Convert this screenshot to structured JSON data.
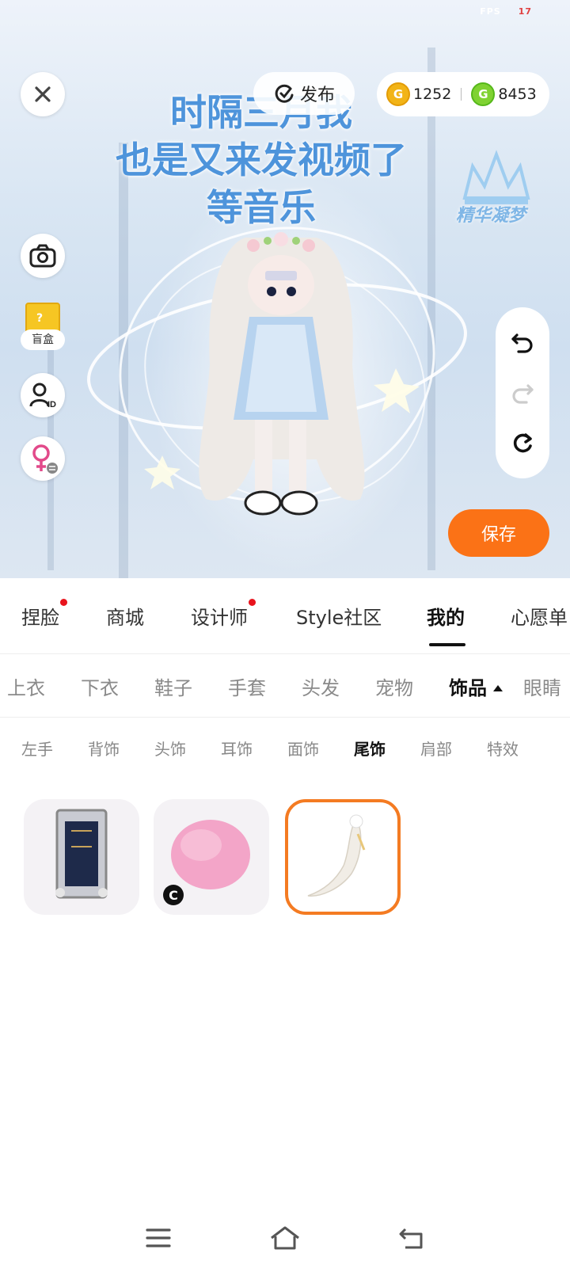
{
  "fps": {
    "label": "FPS",
    "value": "17"
  },
  "header": {
    "publish_label": "发布",
    "gold_coins": "1252",
    "green_coins": "8453"
  },
  "overlay_text": [
    "时隔三月我",
    "也是又来发视频了",
    "等音乐"
  ],
  "logo_text": "精华凝梦",
  "side": {
    "blindbox_label": "盲盒"
  },
  "save_label": "保存",
  "main_tabs": [
    {
      "label": "捏脸",
      "dot": true
    },
    {
      "label": "商城",
      "dot": false
    },
    {
      "label": "设计师",
      "dot": true
    },
    {
      "label": "Style社区",
      "dot": false
    },
    {
      "label": "我的",
      "dot": false,
      "active": true
    },
    {
      "label": "心愿单",
      "dot": false
    }
  ],
  "sub_tabs": [
    {
      "label": "上衣"
    },
    {
      "label": "下衣"
    },
    {
      "label": "鞋子"
    },
    {
      "label": "手套"
    },
    {
      "label": "头发"
    },
    {
      "label": "宠物"
    },
    {
      "label": "饰品",
      "active": true
    },
    {
      "label": "眼睛"
    }
  ],
  "third_tabs": [
    {
      "label": "左手"
    },
    {
      "label": "背饰"
    },
    {
      "label": "头饰"
    },
    {
      "label": "耳饰"
    },
    {
      "label": "面饰"
    },
    {
      "label": "尾饰",
      "active": true
    },
    {
      "label": "肩部"
    },
    {
      "label": "特效"
    }
  ],
  "items": [
    {
      "icon": "mirror-frame-icon",
      "badge": ""
    },
    {
      "icon": "pink-puff-icon",
      "badge": "C"
    },
    {
      "icon": "white-tail-icon",
      "badge": "",
      "selected": true
    }
  ],
  "colors": {
    "accent": "#fb7216",
    "dot": "#e8141d",
    "title_text": "#4e94db"
  }
}
